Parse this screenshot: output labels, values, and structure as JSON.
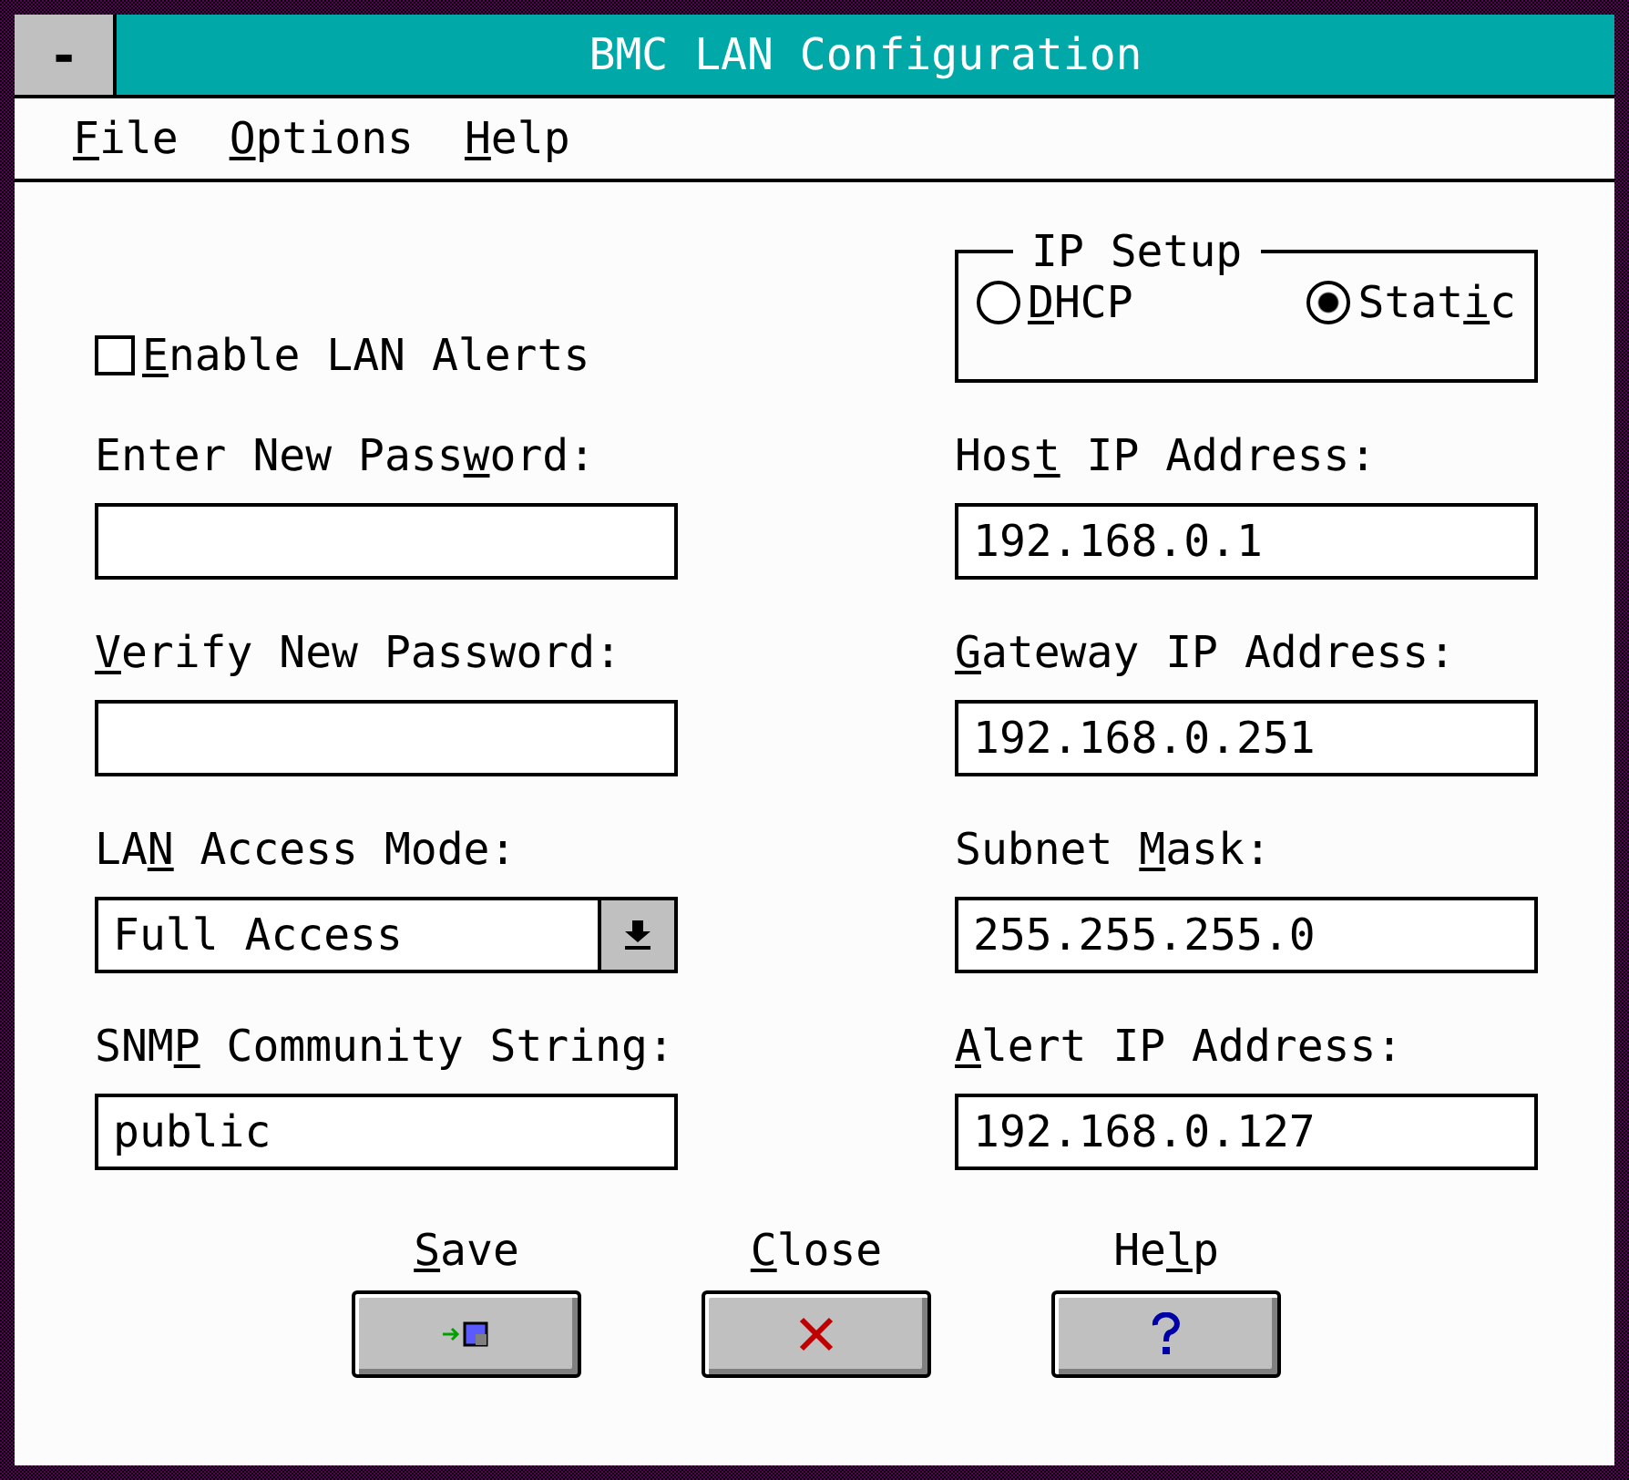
{
  "window": {
    "title": "BMC LAN Configuration",
    "system_menu": "-"
  },
  "menu": [
    {
      "key": "F",
      "post": "ile"
    },
    {
      "key": "O",
      "post": "ptions"
    },
    {
      "key": "H",
      "post": "elp"
    }
  ],
  "enable_lan_alerts": {
    "key": "E",
    "post": "nable LAN Alerts",
    "checked": false
  },
  "ip_setup": {
    "title": "IP Setup",
    "options": [
      {
        "key": "D",
        "post": "HCP",
        "selected": false
      },
      {
        "pre": "Stat",
        "key": "i",
        "post": "c",
        "selected": true
      }
    ]
  },
  "left_fields": [
    {
      "kind": "input",
      "label": {
        "pre": "Enter New Pass",
        "key": "w",
        "post": "ord:"
      }
    },
    {
      "kind": "input",
      "label": {
        "key": "V",
        "post": "erify New Password:"
      }
    },
    {
      "kind": "select",
      "label": {
        "pre": "LA",
        "key": "N",
        "post": " Access Mode:"
      },
      "value": "Full Access"
    },
    {
      "kind": "input",
      "label": {
        "pre": "SNM",
        "key": "P",
        "post": " Community String:"
      },
      "value": "public"
    }
  ],
  "right_fields": [
    {
      "kind": "input",
      "label": {
        "pre": "Hos",
        "key": "t",
        "post": " IP Address:"
      },
      "value": "192.168.0.1"
    },
    {
      "kind": "input",
      "label": {
        "key": "G",
        "post": "ateway IP Address:"
      },
      "value": "192.168.0.251"
    },
    {
      "kind": "input",
      "label": {
        "pre": "Subnet ",
        "key": "M",
        "post": "ask:"
      },
      "value": "255.255.255.0"
    },
    {
      "kind": "input",
      "label": {
        "key": "A",
        "post": "lert IP Address:"
      },
      "value": "192.168.0.127"
    }
  ],
  "buttons": [
    {
      "kind": "save",
      "label": {
        "key": "S",
        "post": "ave"
      }
    },
    {
      "kind": "close",
      "label": {
        "key": "C",
        "post": "lose"
      }
    },
    {
      "kind": "help",
      "label": {
        "pre": "He",
        "key": "l",
        "post": "p"
      }
    }
  ]
}
